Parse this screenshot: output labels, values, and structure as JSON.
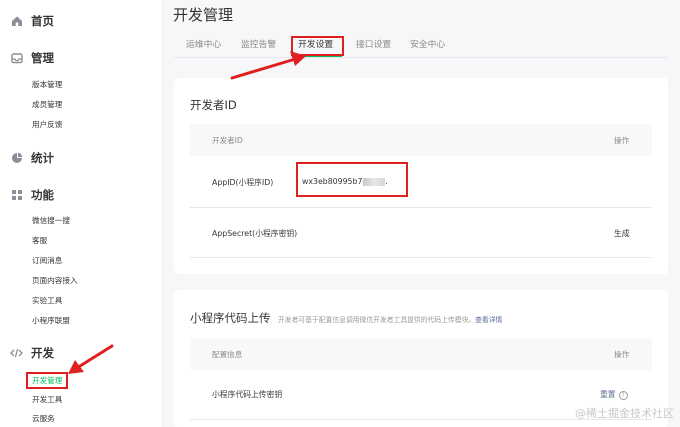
{
  "sidebar": {
    "home": "首页",
    "manage": {
      "title": "管理",
      "items": [
        "版本管理",
        "成员管理",
        "用户反馈"
      ]
    },
    "stats": "统计",
    "features": {
      "title": "功能",
      "items": [
        "微信搜一搜",
        "客服",
        "订阅消息",
        "页面内容接入",
        "实验工具",
        "小程序联盟"
      ]
    },
    "dev": {
      "title": "开发",
      "items": [
        "开发管理",
        "开发工具",
        "云服务"
      ]
    }
  },
  "main": {
    "title": "开发管理",
    "tabs": [
      "运维中心",
      "监控告警",
      "开发设置",
      "接口设置",
      "安全中心"
    ],
    "active_tab": "开发设置",
    "developer_id": {
      "title": "开发者ID",
      "col_id": "开发者ID",
      "col_action": "操作",
      "appid_label": "AppID(小程序ID)",
      "appid_value": "wx3eb80995b7",
      "appid_tail": ".",
      "secret_label": "AppSecret(小程序密钥)",
      "secret_action": "生成"
    },
    "upload": {
      "title": "小程序代码上传",
      "desc": "开发者可基于配置信息调用微信开发者工具提供的代码上传模块。",
      "desc_link": "查看详情",
      "col_config": "配置信息",
      "col_action": "操作",
      "row_label": "小程序代码上传密钥",
      "row_action": "重置"
    }
  },
  "watermark": "@稀土掘金技术社区",
  "colors": {
    "accent": "#07c160",
    "annotation": "#e02020",
    "link": "#576b95"
  }
}
